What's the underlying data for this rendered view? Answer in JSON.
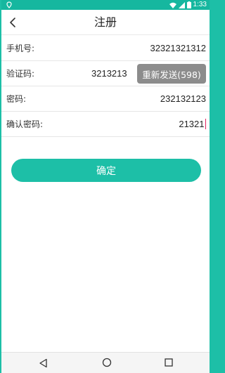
{
  "status_bar": {
    "time": "1:33"
  },
  "header": {
    "title": "注册"
  },
  "form": {
    "phone": {
      "label": "手机号:",
      "value": "32321321312"
    },
    "code": {
      "label": "验证码:",
      "value": "3213213",
      "resend_label": "重新发送(598)"
    },
    "password": {
      "label": "密码:",
      "value": "232132123"
    },
    "confirm_password": {
      "label": "确认密码:",
      "value": "21321"
    }
  },
  "confirm_button": {
    "label": "确定"
  },
  "colors": {
    "accent": "#1dbfa7",
    "resend_bg": "#8c8c8c",
    "cursor": "#e0245e"
  }
}
